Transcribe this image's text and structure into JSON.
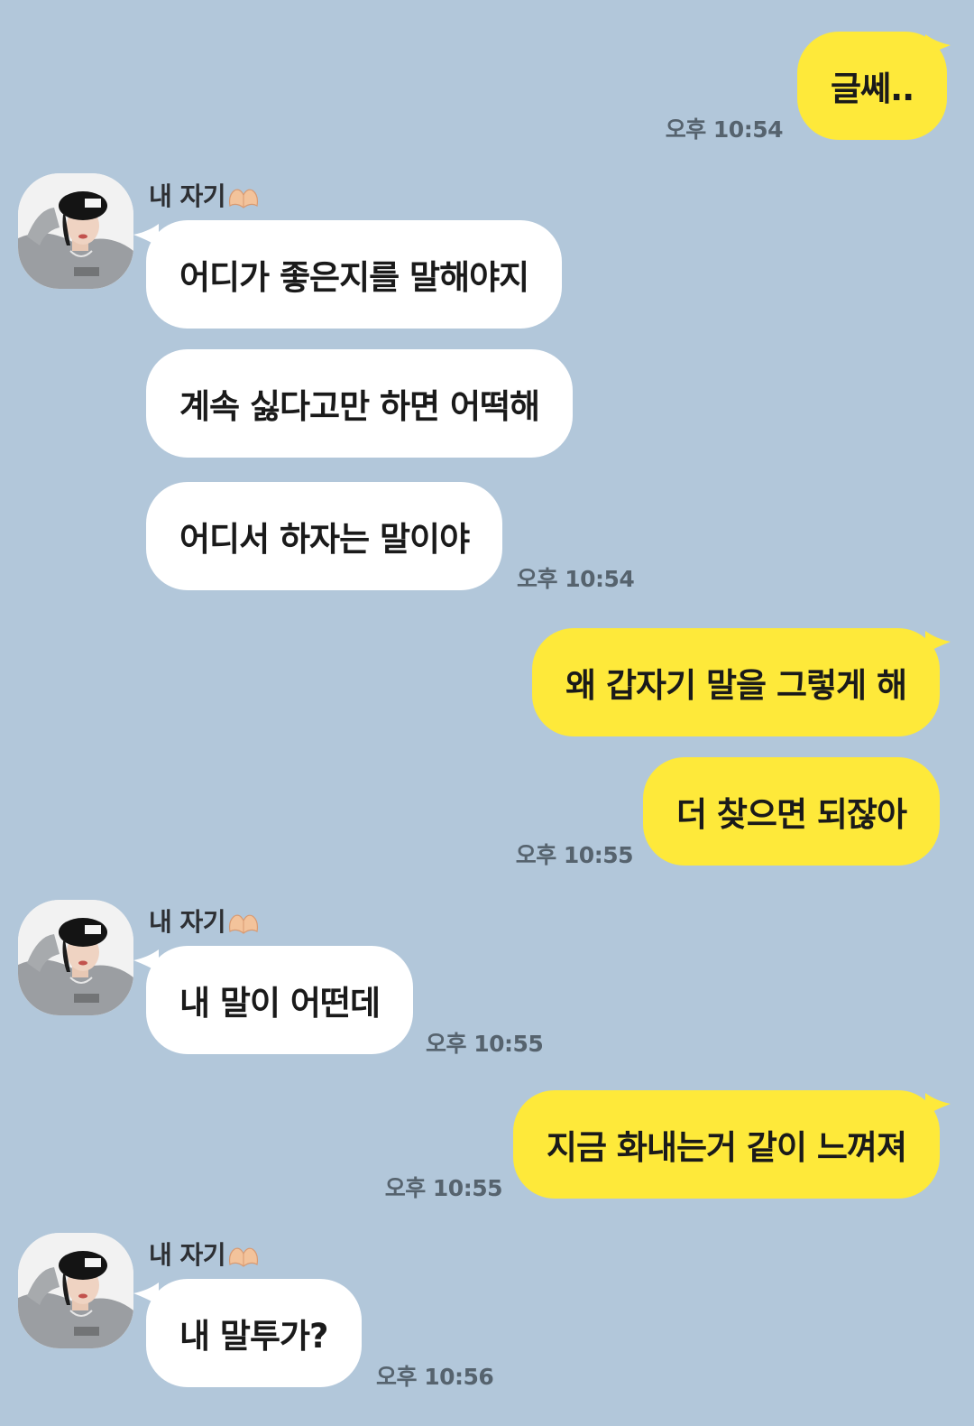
{
  "contact": {
    "name": "내 자기",
    "name_emoji": "heart-hands-emoji"
  },
  "messages": [
    {
      "side": "out",
      "text": "글쎄..",
      "time": "오후 10:54"
    },
    {
      "side": "in",
      "text": "어디가 좋은지를 말해야지",
      "time": ""
    },
    {
      "side": "in",
      "text": "계속 싫다고만 하면 어떡해",
      "time": ""
    },
    {
      "side": "in",
      "text": "어디서 하자는 말이야",
      "time": "오후 10:54"
    },
    {
      "side": "out",
      "text": "왜 갑자기 말을 그렇게 해",
      "time": ""
    },
    {
      "side": "out",
      "text": "더 찾으면 되잖아",
      "time": "오후 10:55"
    },
    {
      "side": "in",
      "text": "내 말이 어떤데",
      "time": "오후 10:55"
    },
    {
      "side": "out",
      "text": "지금 화내는거 같이 느껴져",
      "time": "오후 10:55"
    },
    {
      "side": "in",
      "text": "내 말투가?",
      "time": "오후 10:56"
    }
  ],
  "colors": {
    "background": "#b2c7da",
    "incoming_bubble": "#ffffff",
    "outgoing_bubble": "#fee93a",
    "time_text": "#56636e"
  }
}
